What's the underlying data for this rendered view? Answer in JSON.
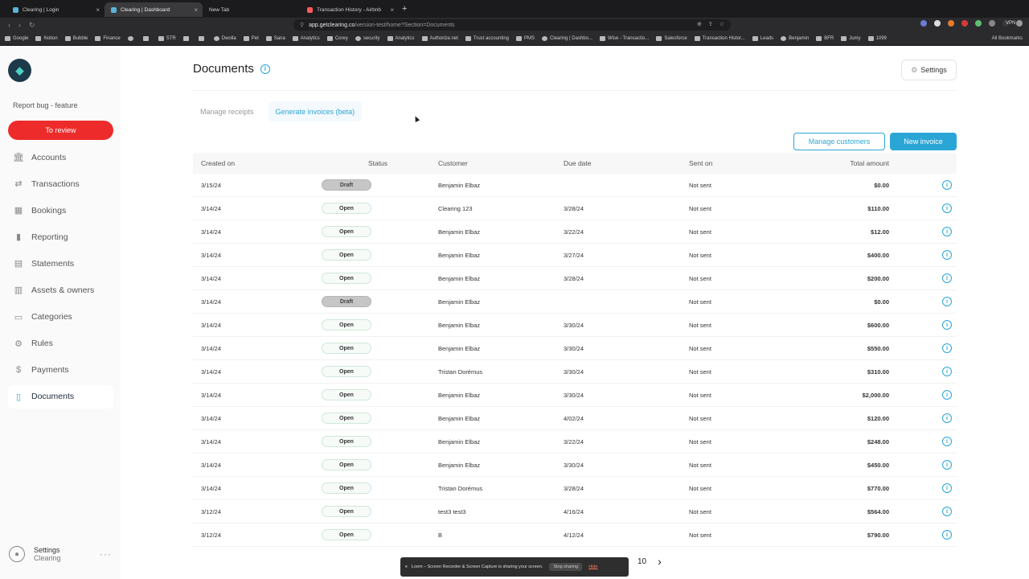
{
  "browser": {
    "tabs": [
      {
        "label": "Clearing | Login",
        "active": false
      },
      {
        "label": "Clearing | Dashboard",
        "active": true
      },
      {
        "label": "New Tab",
        "active": false
      },
      {
        "label": "Transaction History - Airbnb",
        "active": false
      }
    ],
    "url_host": "app.getclearing.co",
    "url_path": "/version-test/home?Section=Documents",
    "vpn_label": "VPN",
    "bookmarks": [
      "Google",
      "Notion",
      "Bubble",
      "Finance",
      "",
      "",
      "STR",
      "",
      "",
      "Dwolla",
      "Pet",
      "Sana",
      "Analytics",
      "Corey",
      "security",
      "Analytics",
      "Authorize.net",
      "Trust accounting",
      "PMS",
      "Clearing | Dashbo...",
      "Wise - Transactio...",
      "Salesforce",
      "Transaction Histor...",
      "Leads",
      "Benjamin",
      "BFR",
      "Jumy",
      "1099"
    ],
    "all_bookmarks": "All Bookmarks"
  },
  "sidebar": {
    "logo_icon": "clearing-logo",
    "report_bug": "Report bug - feature",
    "to_review": "To review",
    "items": [
      {
        "label": "Accounts",
        "icon": "bank-icon",
        "glyph": "🏛"
      },
      {
        "label": "Transactions",
        "icon": "arrows-icon",
        "glyph": "⇄"
      },
      {
        "label": "Bookings",
        "icon": "calendar-icon",
        "glyph": "▦"
      },
      {
        "label": "Reporting",
        "icon": "bar-chart-icon",
        "glyph": "▮"
      },
      {
        "label": "Statements",
        "icon": "file-icon",
        "glyph": "▤"
      },
      {
        "label": "Assets & owners",
        "icon": "building-icon",
        "glyph": "▥"
      },
      {
        "label": "Categories",
        "icon": "folder-icon",
        "glyph": "▭"
      },
      {
        "label": "Rules",
        "icon": "gear-icon",
        "glyph": "⚙"
      },
      {
        "label": "Payments",
        "icon": "dollar-icon",
        "glyph": "$"
      },
      {
        "label": "Documents",
        "icon": "document-icon",
        "glyph": "▯",
        "active": true
      }
    ],
    "user": {
      "name": "Settings",
      "org": "Clearing"
    }
  },
  "header": {
    "title": "Documents",
    "settings_label": "Settings"
  },
  "doc_tabs": [
    "Manage receipts",
    "Generate invoices (beta)"
  ],
  "actions": {
    "manage_customers": "Manage customers",
    "new_invoice": "New invoice"
  },
  "table": {
    "columns": [
      "Created on",
      "Status",
      "Customer",
      "Due date",
      "Sent on",
      "Total amount"
    ],
    "rows": [
      [
        "3/15/24",
        "Draft",
        "Benjamin Elbaz",
        "",
        "Not sent",
        "$0.00"
      ],
      [
        "3/14/24",
        "Open",
        "Clearing 123",
        "3/28/24",
        "Not sent",
        "$110.00"
      ],
      [
        "3/14/24",
        "Open",
        "Benjamin Elbaz",
        "3/22/24",
        "Not sent",
        "$12.00"
      ],
      [
        "3/14/24",
        "Open",
        "Benjamin Elbaz",
        "3/27/24",
        "Not sent",
        "$400.00"
      ],
      [
        "3/14/24",
        "Open",
        "Benjamin Elbaz",
        "3/28/24",
        "Not sent",
        "$200.00"
      ],
      [
        "3/14/24",
        "Draft",
        "Benjamin Elbaz",
        "",
        "Not sent",
        "$0.00"
      ],
      [
        "3/14/24",
        "Open",
        "Benjamin Elbaz",
        "3/30/24",
        "Not sent",
        "$600.00"
      ],
      [
        "3/14/24",
        "Open",
        "Benjamin Elbaz",
        "3/30/24",
        "Not sent",
        "$550.00"
      ],
      [
        "3/14/24",
        "Open",
        "Tristan Dorémus",
        "3/30/24",
        "Not sent",
        "$310.00"
      ],
      [
        "3/14/24",
        "Open",
        "Benjamin Elbaz",
        "3/30/24",
        "Not sent",
        "$2,000.00"
      ],
      [
        "3/14/24",
        "Open",
        "Benjamin Elbaz",
        "4/02/24",
        "Not sent",
        "$120.00"
      ],
      [
        "3/14/24",
        "Open",
        "Benjamin Elbaz",
        "3/22/24",
        "Not sent",
        "$248.00"
      ],
      [
        "3/14/24",
        "Open",
        "Benjamin Elbaz",
        "3/30/24",
        "Not sent",
        "$450.00"
      ],
      [
        "3/14/24",
        "Open",
        "Tristan Dorémus",
        "3/28/24",
        "Not sent",
        "$770.00"
      ],
      [
        "3/12/24",
        "Open",
        "test3 test3",
        "4/16/24",
        "Not sent",
        "$564.00"
      ],
      [
        "3/12/24",
        "Open",
        "B",
        "4/12/24",
        "Not sent",
        "$790.00"
      ]
    ]
  },
  "pagination": {
    "page": "10"
  },
  "loom": {
    "message": "Loom – Screen Recorder & Screen Capture is sharing your screen.",
    "stop": "Stop sharing",
    "hide": "Hide"
  },
  "colors": {
    "accent": "#2aa6d6",
    "review": "#ee2b2b"
  }
}
